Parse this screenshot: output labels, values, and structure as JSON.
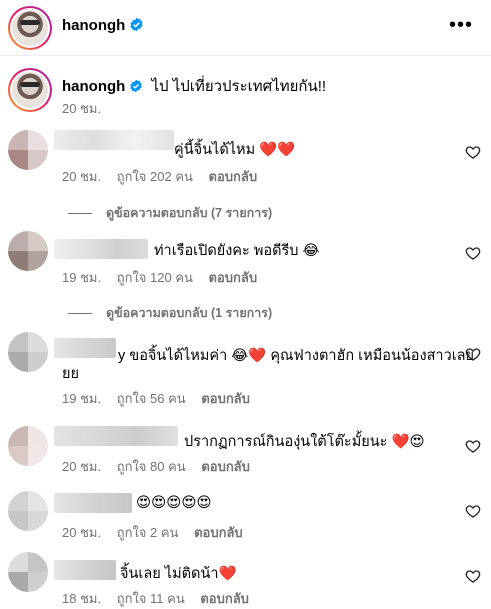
{
  "post": {
    "username": "hanongh",
    "caption": "ไป ไปเที่ยวประเทศไทยกัน!!",
    "caption_time": "20 ชม."
  },
  "icons": {
    "verified": "verified-badge-icon",
    "more": "more-options-icon",
    "like": "heart-outline-icon"
  },
  "colors": {
    "verified_blue": "#0095f6",
    "meta_gray": "#737373",
    "heart_red": "#e0212b"
  },
  "comments": [
    {
      "text": "คู่นี้จิ้นได้ไหม ❤️❤️",
      "time": "20 ชม.",
      "likes": "ถูกใจ 202 คน",
      "reply": "ตอบกลับ",
      "view_replies": "ดูข้อความตอบกลับ (7 รายการ)"
    },
    {
      "text": "ท่าเรือเปิดยังคะ พอดีรีบ 😂",
      "time": "19 ชม.",
      "likes": "ถูกใจ 120 คน",
      "reply": "ตอบกลับ",
      "view_replies": "ดูข้อความตอบกลับ (1 รายการ)"
    },
    {
      "text_line1": "y ขอจิ้นได้ไหมค่า 😂❤️ คุณฟางตาฮัก เหมือนน้องสาวเลย",
      "text_line2": "ยย",
      "time": "19 ชม.",
      "likes": "ถูกใจ 56 คน",
      "reply": "ตอบกลับ"
    },
    {
      "text": "ปรากฏการณ์กินองุ่นใต้โต๊ะมั้ยนะ ❤️😍",
      "time": "20 ชม.",
      "likes": "ถูกใจ 80 คน",
      "reply": "ตอบกลับ"
    },
    {
      "text": "😍😍😍😍😍",
      "time": "20 ชม.",
      "likes": "ถูกใจ 2 คน",
      "reply": "ตอบกลับ"
    },
    {
      "text": "จิ้นเลย ไม่ติดน้า❤️",
      "time": "18 ชม.",
      "likes": "ถูกใจ 11 คน",
      "reply": "ตอบกลับ"
    }
  ]
}
